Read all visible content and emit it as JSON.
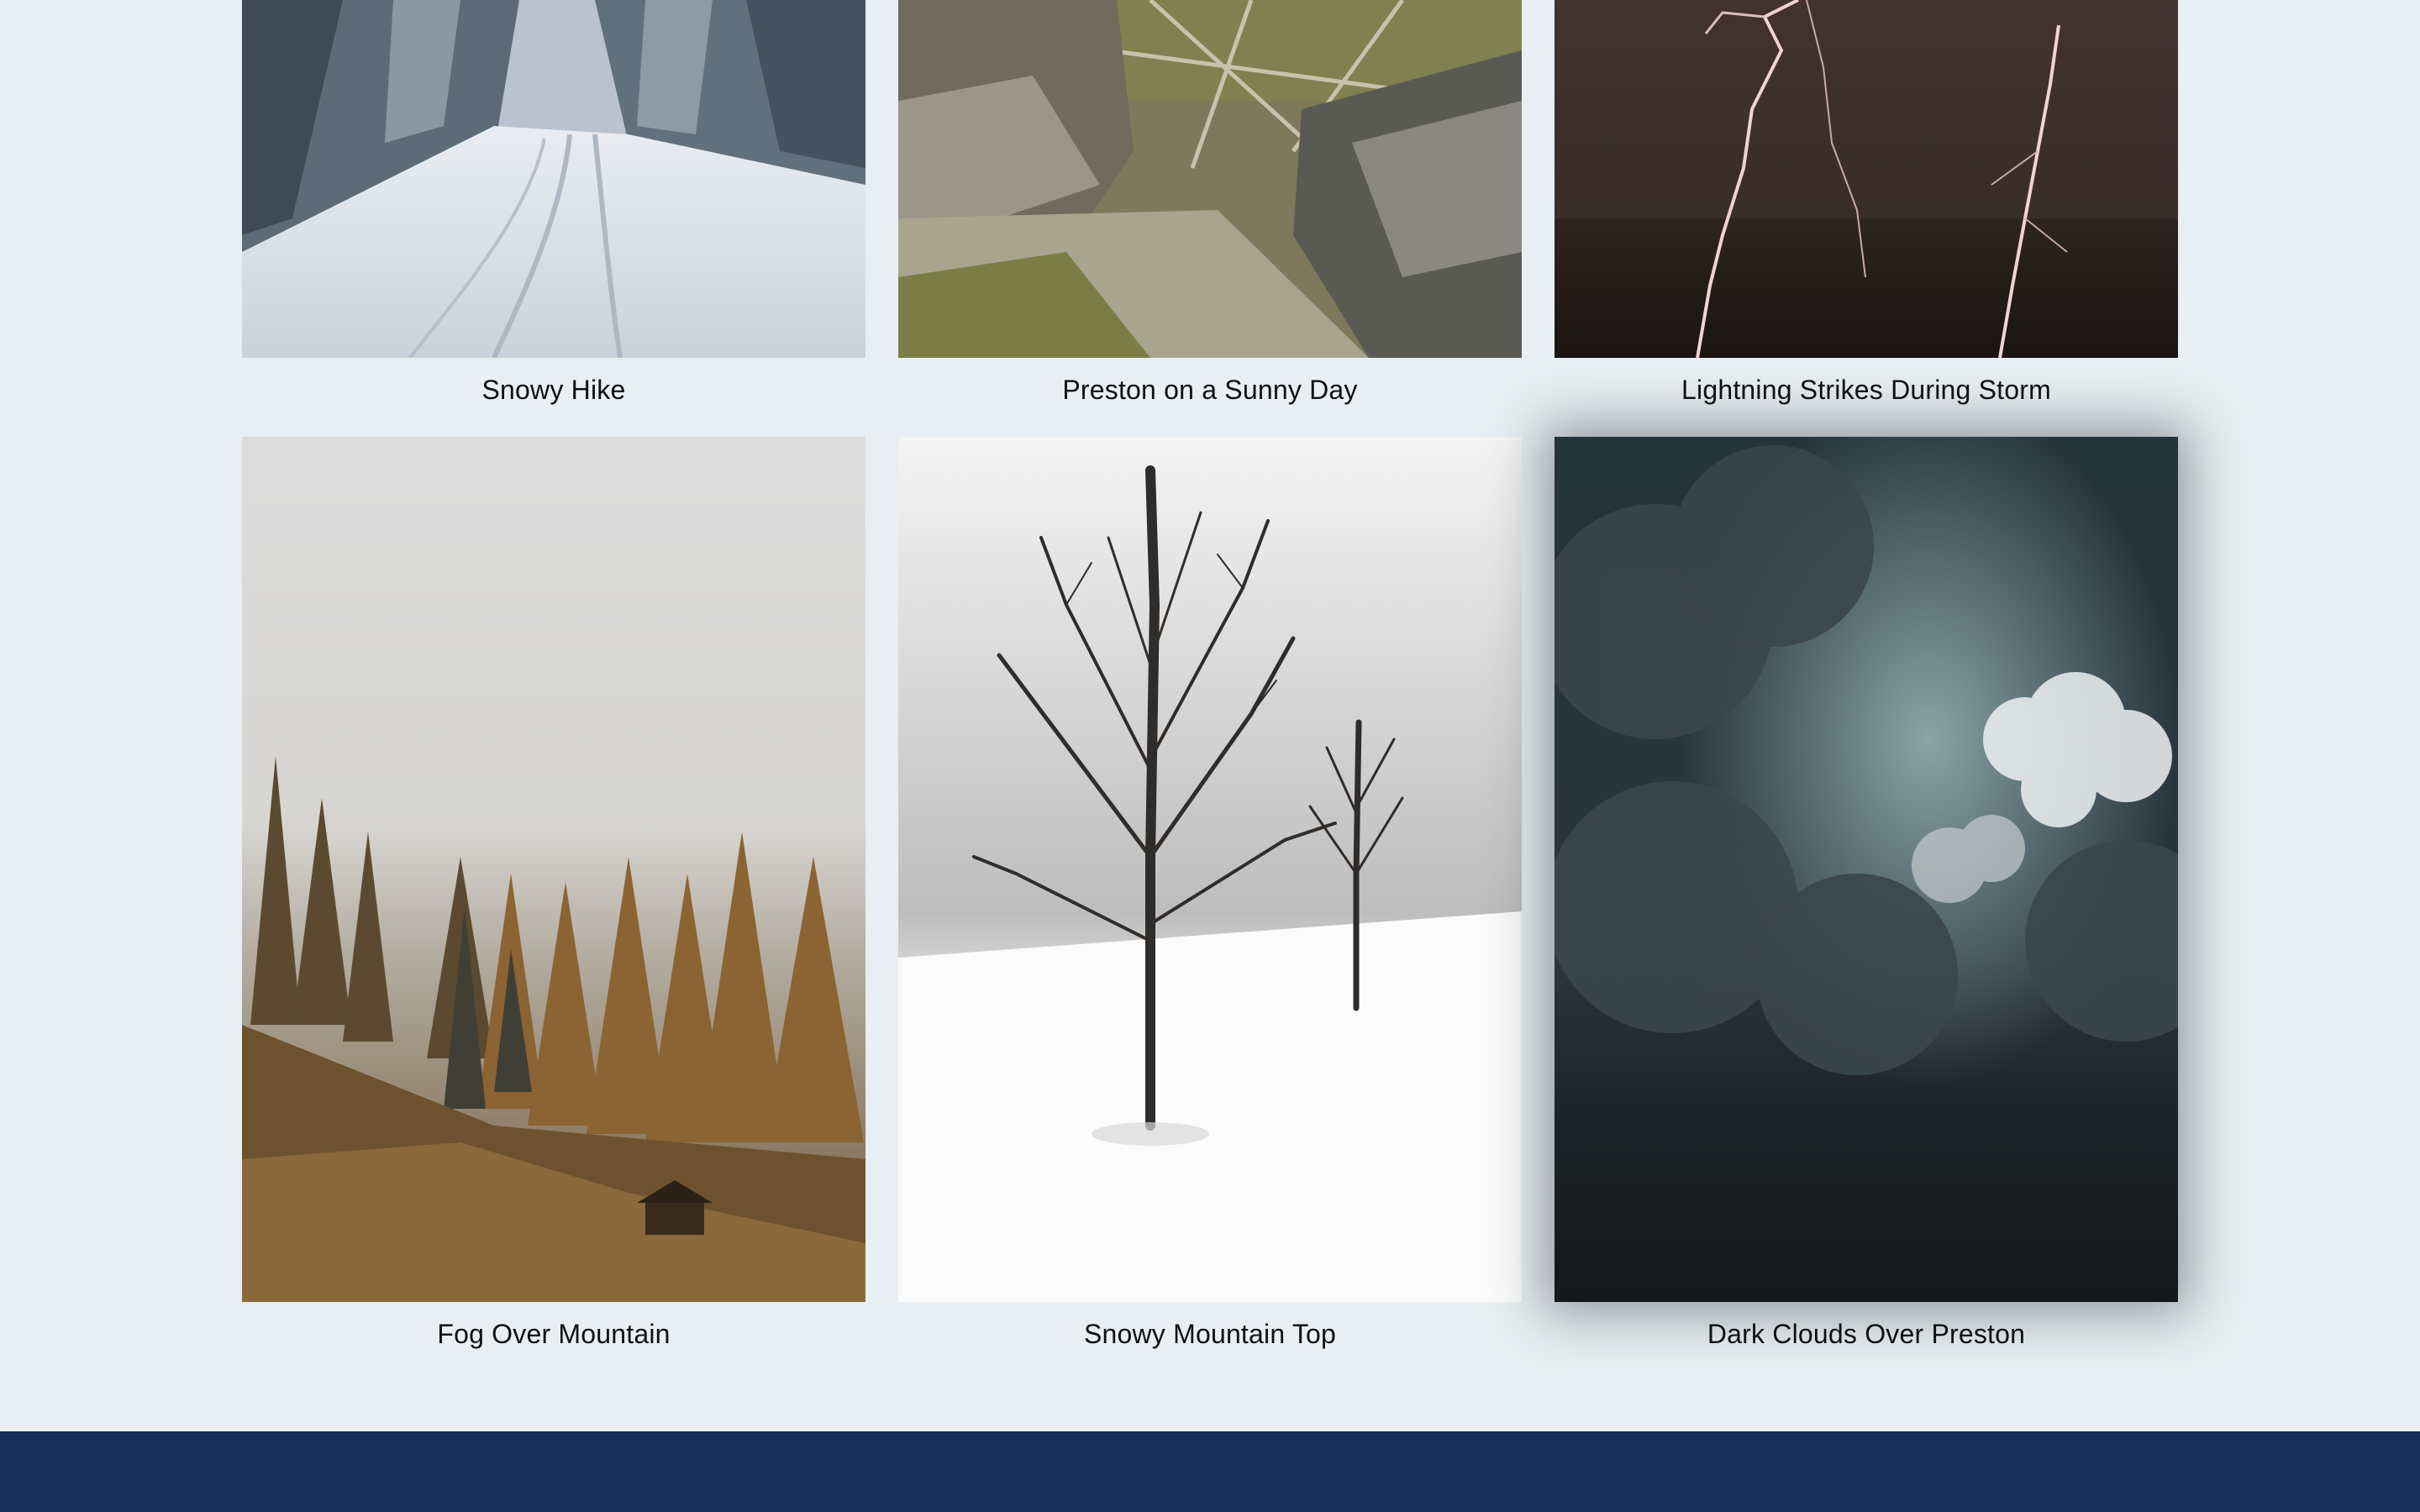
{
  "colors": {
    "page_background": "#e8eef1",
    "footer_background": "#17305a",
    "caption_text": "#111111"
  },
  "gallery": {
    "items": [
      {
        "caption": "Snowy Hike",
        "icon": "snowy-road-photo"
      },
      {
        "caption": "Preston on a Sunny Day",
        "icon": "rocky-valley-photo"
      },
      {
        "caption": "Lightning Strikes During Storm",
        "icon": "lightning-photo"
      },
      {
        "caption": "Fog Over Mountain",
        "icon": "foggy-forest-photo"
      },
      {
        "caption": "Snowy Mountain Top",
        "icon": "bare-trees-snow-photo"
      },
      {
        "caption": "Dark Clouds Over Preston",
        "icon": "dark-clouds-photo"
      }
    ]
  },
  "footer": {}
}
